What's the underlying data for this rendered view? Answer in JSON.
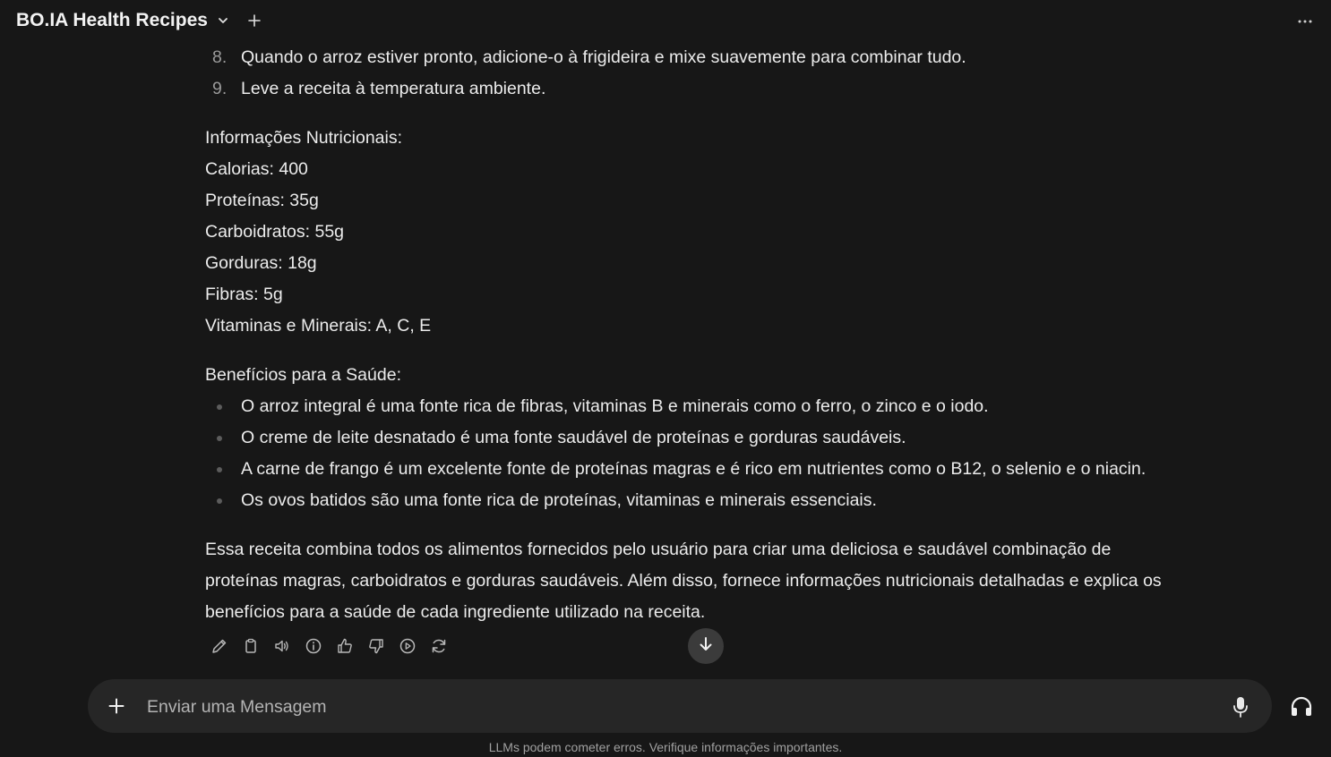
{
  "header": {
    "model_name": "BO.IA Health Recipes",
    "chevron_icon": "chevron-down-icon",
    "new_chat_icon": "plus-icon",
    "menu_icon": "more-horizontal-icon"
  },
  "steps": [
    {
      "num": "8.",
      "text": "Quando o arroz estiver pronto, adicione-o à frigideira e mixe suavemente para combinar tudo."
    },
    {
      "num": "9.",
      "text": "Leve a receita à temperatura ambiente."
    }
  ],
  "nutrition": {
    "heading": "Informações Nutricionais:",
    "lines": [
      "Calorias: 400",
      "Proteínas: 35g",
      "Carboidratos: 55g",
      "Gorduras: 18g",
      "Fibras: 5g",
      "Vitaminas e Minerais: A, C, E"
    ]
  },
  "benefits": {
    "heading": "Benefícios para a Saúde:",
    "items": [
      "O arroz integral é uma fonte rica de fibras, vitaminas B e minerais como o ferro, o zinco e o iodo.",
      "O creme de leite desnatado é uma fonte saudável de proteínas e gorduras saudáveis.",
      "A carne de frango é um excelente fonte de proteínas magras e é rico em nutrientes como o B12, o selenio e o niacin.",
      "Os ovos batidos são uma fonte rica de proteínas, vitaminas e minerais essenciais."
    ]
  },
  "summary": {
    "lines": [
      "Essa receita combina todos os alimentos fornecidos pelo usuário para criar uma deliciosa e saudável combinação de",
      "proteínas magras, carboidratos e gorduras saudáveis. Além disso, fornece informações nutricionais detalhadas e explica os",
      "benefícios para a saúde de cada ingrediente utilizado na receita."
    ]
  },
  "message_actions": [
    "edit-icon",
    "copy-icon",
    "read-aloud-icon",
    "info-icon",
    "thumbs-up-icon",
    "thumbs-down-icon",
    "continue-icon",
    "regenerate-icon"
  ],
  "composer": {
    "placeholder": "Enviar uma Mensagem",
    "value": "",
    "add_icon": "plus-icon",
    "mic_icon": "microphone-icon",
    "call_icon": "headphones-icon"
  },
  "footer": {
    "disclaimer": "LLMs podem cometer erros. Verifique informações importantes."
  },
  "colors": {
    "background": "#171717",
    "composer_bg": "#262626",
    "text": "#ececec",
    "muted": "#9a9a9a"
  }
}
